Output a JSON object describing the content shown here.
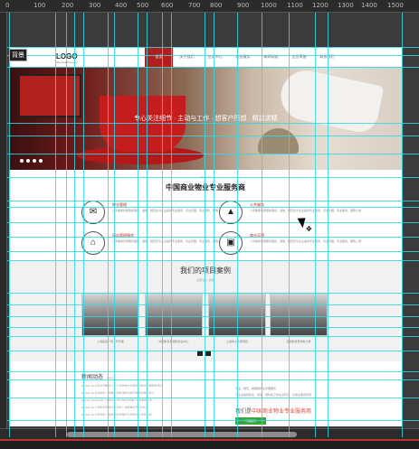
{
  "ruler": {
    "labels": [
      "0",
      "100",
      "200",
      "300",
      "400",
      "500",
      "600",
      "700",
      "800",
      "900",
      "1000",
      "1100",
      "1200",
      "1300",
      "1400",
      "1500"
    ]
  },
  "document_tab": "背景",
  "site": {
    "logo": "LOGO",
    "logo_sub": "Sinowell Property",
    "nav": [
      "首页",
      "关于我们",
      "业务中心",
      "物业服务",
      "新闻动态",
      "企业荣誉",
      "联系我们"
    ],
    "nav_active_index": 0,
    "hero_text": "专心关注细节 · 主动与工作 · 想客户所想 · 精益求精",
    "hero_slides": 4,
    "section_small": "About us",
    "section_title": "中国商业物业专业服务商",
    "services": [
      {
        "icon": "tag-icon",
        "glyph": "✉",
        "title": "物业管理",
        "desc": "公司秉承优质服务理念，诚信、规范化为业主提供专业服务，专业管理，专业服务，细致入微"
      },
      {
        "icon": "building-icon",
        "glyph": "▲",
        "title": "公共服务",
        "desc": "公司秉承优质服务理念，诚信、规范化为业主提供专业服务，专业管理，专业服务，细致入微"
      },
      {
        "icon": "service-bell-icon",
        "glyph": "⌂",
        "title": "酒店管理服务",
        "desc": "公司秉承优质服务理念，诚信、规范化为业主提供专业服务，专业管理，专业服务，细致入微"
      },
      {
        "icon": "shop-icon",
        "glyph": "▣",
        "title": "商业运营",
        "desc": "公司秉承优质服务理念，诚信、规范化为业主提供专业服务，专业管理，专业服务，细致入微"
      }
    ],
    "cases": {
      "title": "我们的项目案例",
      "tabs": "全部    办公    商场",
      "items": [
        {
          "caption": "上海某某广场 · 写字楼"
        },
        {
          "caption": "中国新世界国际商业中心"
        },
        {
          "caption": "上海中心大厦项目"
        },
        {
          "caption": "深圳新世界商务大厦"
        }
      ]
    },
    "news": {
      "title": "新闻动态",
      "more": "News",
      "lines": [
        "2014-6-18 今年全国物业公司上海市物业管理企业物业管理服务培训",
        "2014-6-18 某某物业公司举办年度消防演练活动物业服务评比",
        "2014-6-18 2014年上海物业公司与物业管理行业发展研讨会",
        "2014-6-18 公司新项目签约仪式在上海隆重召开签约仪式",
        "2014-6-18 今年年度上海市物业管理行业优秀企业评选活动"
      ]
    },
    "right_text": [
      "专业、规范、精细的物业管理服务",
      "为业主提供安全、舒适、便利的工作生活环境，让物业保值增值"
    ],
    "contact_prefix": "我们是",
    "contact_highlight": "中国商业物业专业服务商",
    "contact_button": "了解我们"
  }
}
